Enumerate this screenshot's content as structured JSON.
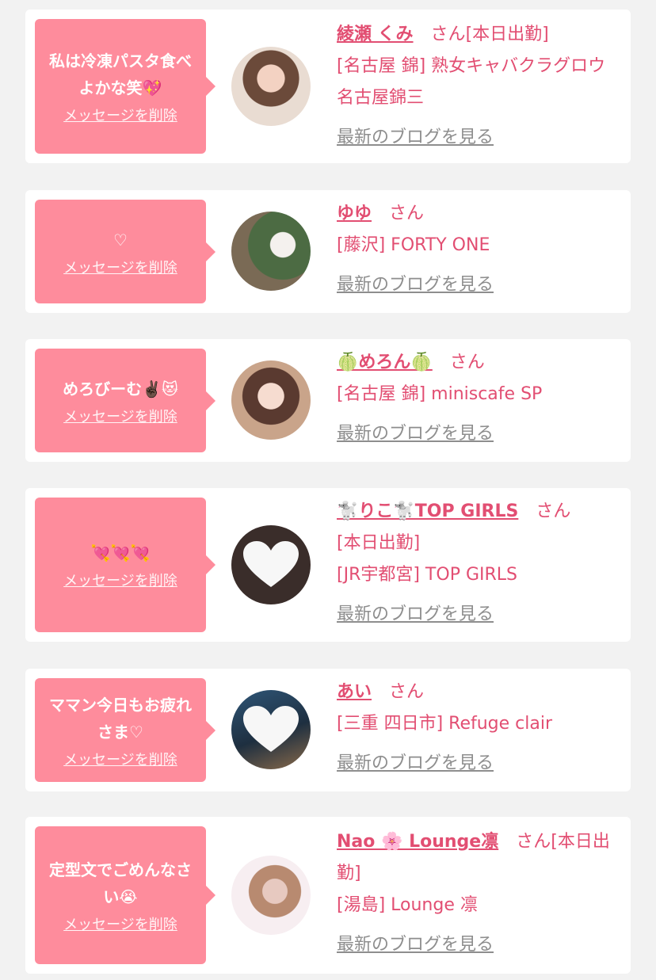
{
  "delete_label": "メッセージを削除",
  "blog_label": "最新のブログを見る",
  "san_label": "さん",
  "colors": {
    "accent": "#e24e72",
    "bubble": "#fe8c9c",
    "link_gray": "#8e8e8e"
  },
  "items": [
    {
      "message": "私は冷凍パスタ食べよかな笑💖",
      "name": "綾瀬 くみ",
      "suffix": "[本日出勤]",
      "details": [
        "[名古屋 錦] 熟女キャバクラグロウ 名古屋錦三"
      ]
    },
    {
      "message": "♡",
      "name": "ゆゆ",
      "suffix": "",
      "details": [
        "[藤沢] FORTY ONE"
      ]
    },
    {
      "message": "めろびーむ✌🏿😻",
      "name": "🍈めろん🍈",
      "suffix": "",
      "details": [
        "[名古屋 錦] miniscafe SP"
      ]
    },
    {
      "message": "💘💘💘",
      "name": "🐩りこ🐩TOP GIRLS",
      "suffix": "",
      "details": [
        "[本日出勤]",
        "[JR宇都宮] TOP GIRLS"
      ]
    },
    {
      "message": "ママン今日もお疲れさま♡",
      "name": "あい",
      "suffix": "",
      "details": [
        "[三重 四日市] Refuge clair"
      ]
    },
    {
      "message": "定型文でごめんなさい😭",
      "name": "Nao 🌸 Lounge凛",
      "suffix": "[本日出勤]",
      "details": [
        "[湯島] Lounge 凛"
      ]
    }
  ]
}
